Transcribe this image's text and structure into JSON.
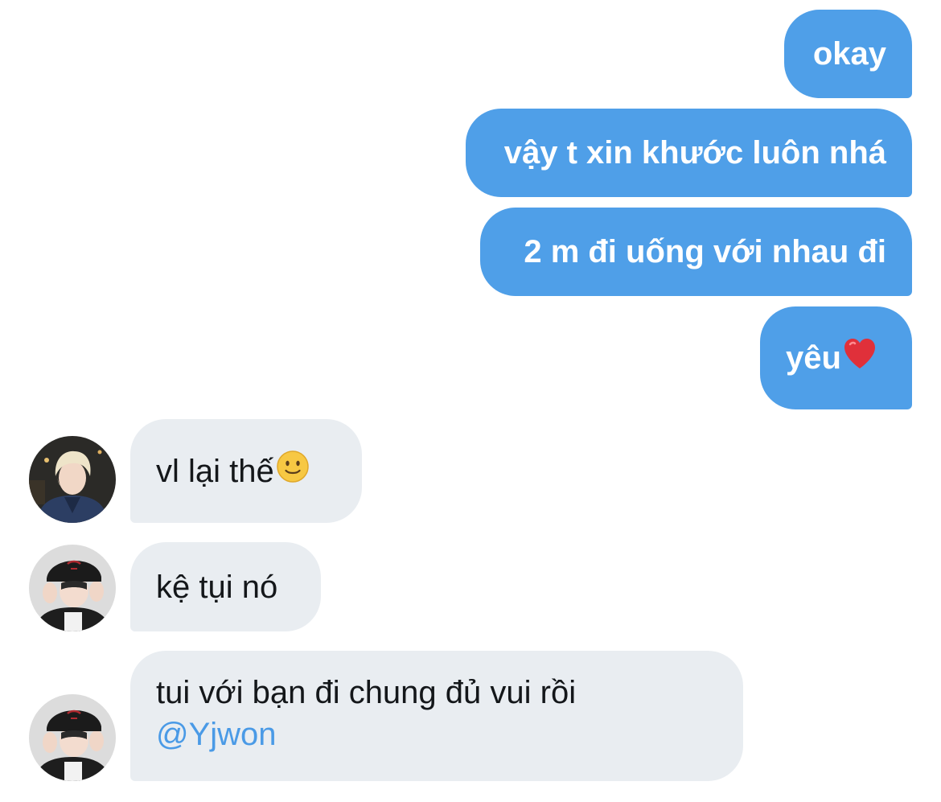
{
  "messages": [
    {
      "direction": "outgoing",
      "text": "okay"
    },
    {
      "direction": "outgoing",
      "text": "vậy t xin khước luôn nhá"
    },
    {
      "direction": "outgoing",
      "text": "2 m đi uống với nhau đi"
    },
    {
      "direction": "outgoing",
      "text": "yêu",
      "emoji": "red-heart-icon"
    },
    {
      "direction": "incoming",
      "text": "vl lại thế",
      "emoji": "slightly-smiling-face-icon",
      "avatar": "avatar-blond-hair"
    },
    {
      "direction": "incoming",
      "text": "kệ tụi nó",
      "avatar": "avatar-black-cap"
    },
    {
      "direction": "incoming",
      "text": "tui với bạn đi chung đủ vui rồi",
      "mention": "@Yjwon",
      "avatar": "avatar-black-cap"
    }
  ],
  "colors": {
    "outgoing_bubble": "#4f9fe8",
    "incoming_bubble": "#e9edf1",
    "mention": "#4a9ae6",
    "background": "#ffffff"
  }
}
